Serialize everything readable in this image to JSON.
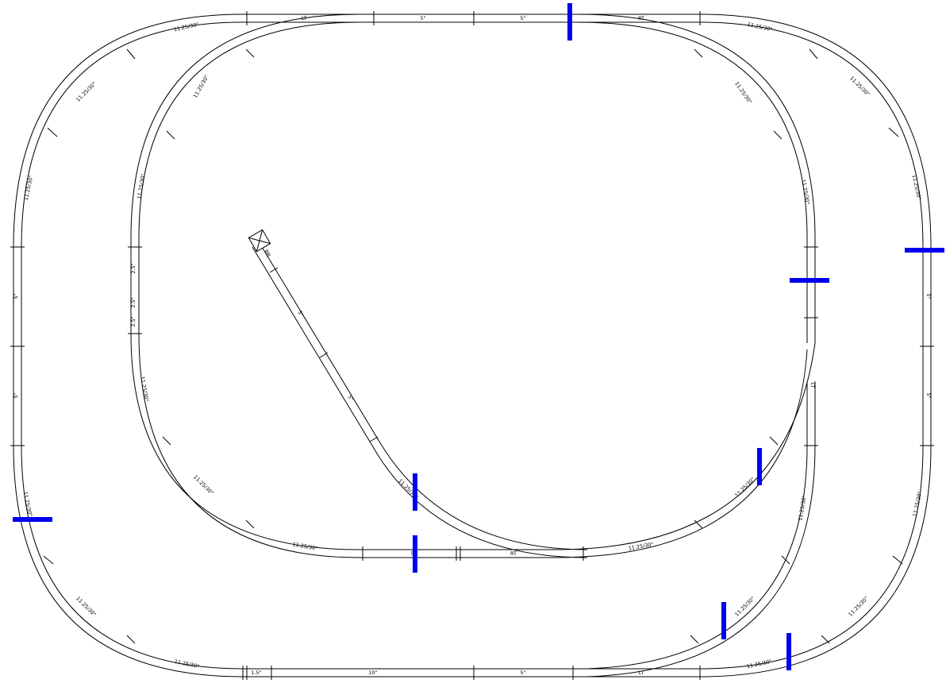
{
  "labels": {
    "top_lt": "LT",
    "top_5a": "5\"",
    "top_5b": "5\"",
    "top_rt": "RT",
    "outer_curve_tl1": "11.25/30\"",
    "outer_curve_tl2": "11.25/30\"",
    "outer_curve_tl3": "11.25/30\"",
    "outer_curve_tr1": "11.25/30\"",
    "outer_curve_tr2": "11.25/30\"",
    "outer_curve_tr3": "11.25/30\"",
    "outer_left_a": "5\"",
    "outer_left_b": "5\"",
    "outer_right_a": "5\"",
    "outer_right_b": "5\"",
    "outer_curve_bl1": "11.25/30\"",
    "outer_curve_bl2": "11.25/30\"",
    "outer_curve_bl3": "11.25/30\"",
    "outer_curve_br1": "11.25/30\"",
    "outer_curve_br2": "11.25/30\"",
    "outer_curve_br3": "11.25/30\"",
    "bottom_15": "1.5\"",
    "bottom_10": "10\"",
    "bottom_5": "5\"",
    "bottom_lt": "LT",
    "inner_curve_tl1": "11.25/30\"",
    "inner_curve_tl2": "11.25/30\"",
    "inner_curve_tr1": "11.25/30\"",
    "inner_curve_tr2": "11.25/30\"",
    "inner_left_a": "2.5\"",
    "inner_left_b": "2.5\"",
    "inner_left_c": "2.5\"",
    "inner_curve_bl1": "11.25/30\"",
    "inner_curve_bl2": "11.25/30\"",
    "inner_curve_bl3": "11.25/30\"",
    "inner_curve_br1": "11.25/30\"",
    "inner_bottom_5": "5\"",
    "inner_bottom_rt": "RT",
    "inner_right_5": "5\"",
    "inner_right_lt": "LT",
    "spur_bb": "BB",
    "spur_5a": "5\"",
    "spur_5b": "5\"",
    "spur_curve": "11.25/30\"",
    "siding_curve1": "11.25/30\"",
    "siding_curve2": "11.25/30\""
  },
  "colors": {
    "track": "#000000",
    "block_marker": "#0000ee",
    "background": "#ffffff"
  }
}
